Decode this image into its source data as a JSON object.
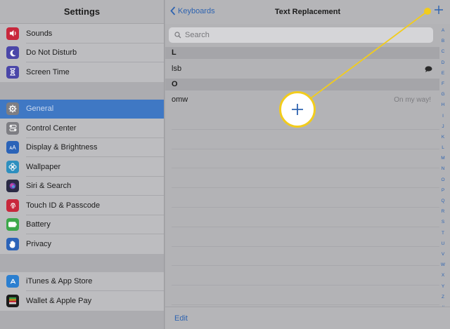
{
  "sidebar": {
    "title": "Settings",
    "groups": [
      [
        {
          "label": "Sounds",
          "icon": "speaker-icon",
          "color": "#c8273c"
        },
        {
          "label": "Do Not Disturb",
          "icon": "moon-icon",
          "color": "#4a46a8"
        },
        {
          "label": "Screen Time",
          "icon": "hourglass-icon",
          "color": "#4a46a8"
        }
      ],
      [
        {
          "label": "General",
          "icon": "gear-icon",
          "color": "#7e7e83",
          "selected": true
        },
        {
          "label": "Control Center",
          "icon": "toggles-icon",
          "color": "#7e7e83"
        },
        {
          "label": "Display & Brightness",
          "icon": "text-size-icon",
          "color": "#2b63b8"
        },
        {
          "label": "Wallpaper",
          "icon": "flower-icon",
          "color": "#2d8fbf"
        },
        {
          "label": "Siri & Search",
          "icon": "siri-icon",
          "color": "#2a2a44"
        },
        {
          "label": "Touch ID & Passcode",
          "icon": "fingerprint-icon",
          "color": "#c8273c"
        },
        {
          "label": "Battery",
          "icon": "battery-icon",
          "color": "#3ca84a"
        },
        {
          "label": "Privacy",
          "icon": "hand-icon",
          "color": "#2b63b8"
        }
      ],
      [
        {
          "label": "iTunes & App Store",
          "icon": "app-store-icon",
          "color": "#2b7fd0"
        },
        {
          "label": "Wallet & Apple Pay",
          "icon": "wallet-icon",
          "color": "#1c1c1c"
        }
      ]
    ]
  },
  "nav": {
    "back_label": "Keyboards",
    "title": "Text Replacement",
    "add_label": "+"
  },
  "search": {
    "placeholder": "Search"
  },
  "sections": [
    {
      "letter": "L",
      "rows": [
        {
          "shortcut": "lsb",
          "phrase": ""
        }
      ]
    },
    {
      "letter": "O",
      "rows": [
        {
          "shortcut": "omw",
          "phrase": "On my way!"
        }
      ]
    }
  ],
  "index_letters": [
    "A",
    "B",
    "C",
    "D",
    "E",
    "F",
    "G",
    "H",
    "I",
    "J",
    "K",
    "L",
    "M",
    "N",
    "O",
    "P",
    "Q",
    "R",
    "S",
    "T",
    "U",
    "V",
    "W",
    "X",
    "Y",
    "Z",
    "#"
  ],
  "footer": {
    "edit_label": "Edit"
  },
  "accent_color": "#2f64b0",
  "callout_color": "#f2cc1c"
}
